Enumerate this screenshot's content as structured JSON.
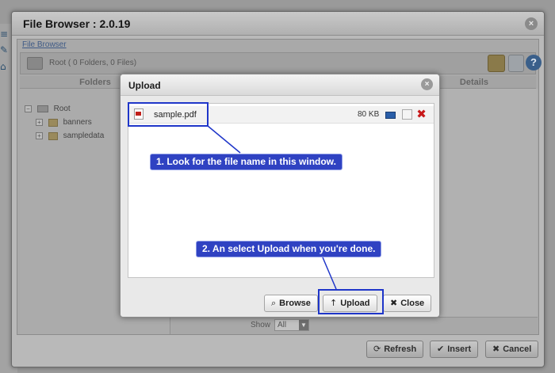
{
  "file_browser": {
    "title": "File Browser : 2.0.19",
    "breadcrumb": "File Browser",
    "path_text": "Root  ( 0 Folders, 0 Files)",
    "column_folders": "Folders",
    "column_details": "Details",
    "tree": {
      "root_label": "Root",
      "root_toggle": "−",
      "children": [
        {
          "label": "banners",
          "toggle": "+"
        },
        {
          "label": "sampledata",
          "toggle": "+"
        }
      ]
    },
    "show_label": "Show",
    "show_value": "All",
    "buttons": {
      "refresh": "Refresh",
      "insert": "Insert",
      "cancel": "Cancel"
    },
    "help_glyph": "?"
  },
  "upload_dialog": {
    "title": "Upload",
    "files": [
      {
        "name": "sample.pdf",
        "size": "80 KB"
      }
    ],
    "buttons": {
      "browse": "Browse",
      "upload": "Upload",
      "close": "Close"
    }
  },
  "annotations": {
    "step1": "1. Look for the file name in this window.",
    "step2": "2. An select Upload when you're done."
  },
  "colors": {
    "annotation_blue": "#2f42c2",
    "delete_red": "#c8191a"
  },
  "icons": {
    "close": "close-icon",
    "refresh": "refresh-icon",
    "insert": "checkmark-icon",
    "cancel": "x-icon",
    "browse": "search-icon",
    "upload": "upload-arrow-icon",
    "delete": "delete-icon"
  }
}
